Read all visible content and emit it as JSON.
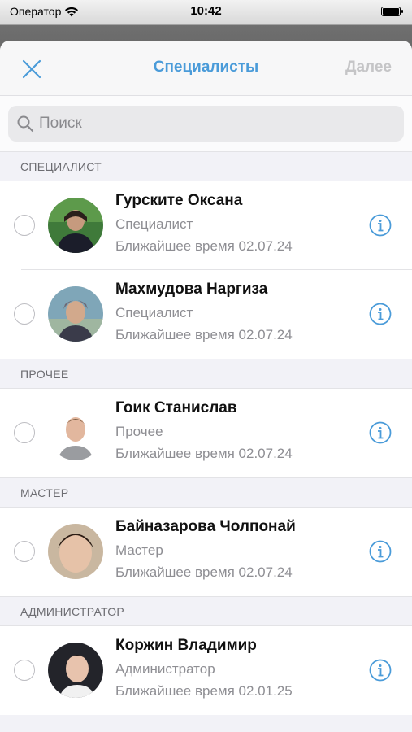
{
  "status": {
    "carrier": "Оператор",
    "time": "10:42"
  },
  "nav": {
    "title": "Специалисты",
    "next": "Далее"
  },
  "search": {
    "placeholder": "Поиск"
  },
  "sections": [
    {
      "title": "СПЕЦИАЛИСТ",
      "items": [
        {
          "name": "Гурските Оксана",
          "role": "Специалист",
          "time": "Ближайшее время 02.07.24"
        },
        {
          "name": "Махмудова Наргиза",
          "role": "Специалист",
          "time": "Ближайшее время 02.07.24"
        }
      ]
    },
    {
      "title": "ПРОЧЕЕ",
      "items": [
        {
          "name": "Гоик Станислав",
          "role": "Прочее",
          "time": "Ближайшее время 02.07.24"
        }
      ]
    },
    {
      "title": "МАСТЕР",
      "items": [
        {
          "name": "Байназарова Чолпонай",
          "role": "Мастер",
          "time": "Ближайшее время 02.07.24"
        }
      ]
    },
    {
      "title": "АДМИНИСТРАТОР",
      "items": [
        {
          "name": "Коржин Владимир",
          "role": "Администратор",
          "time": "Ближайшее время 02.01.25"
        }
      ]
    }
  ],
  "colors": {
    "accent": "#4a9bd9",
    "disabled": "#c5c5c7",
    "secondary_text": "#8e8e93"
  }
}
